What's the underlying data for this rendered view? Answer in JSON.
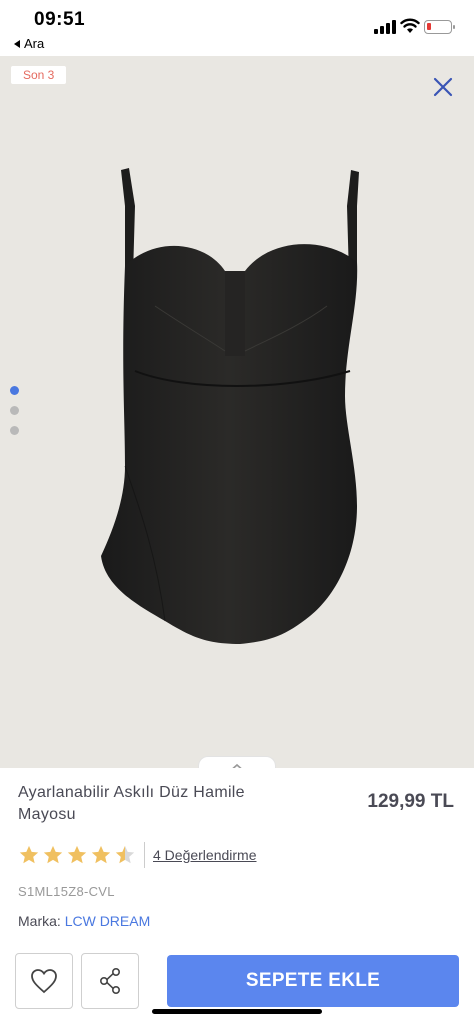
{
  "status_bar": {
    "time": "09:51",
    "back_label": "Ara"
  },
  "gallery": {
    "badge": "Son 3",
    "close_icon": "close-icon",
    "dots": [
      true,
      false,
      false
    ],
    "image": "black one-piece swimsuit"
  },
  "product": {
    "title": "Ayarlanabilir Askılı Düz Hamile Mayosu",
    "price": "129,99 TL",
    "rating_stars": 4.5,
    "reviews_label": "4 Değerlendirme",
    "sku": "S1ML15Z8-CVL",
    "brand_label": "Marka:",
    "brand_name": "LCW DREAM"
  },
  "actions": {
    "favorite_icon": "heart-icon",
    "share_icon": "share-icon",
    "add_to_cart_label": "SEPETE EKLE"
  },
  "colors": {
    "accent": "#5b86ee",
    "star": "#f0c060",
    "badge_text": "#e56a5f"
  }
}
